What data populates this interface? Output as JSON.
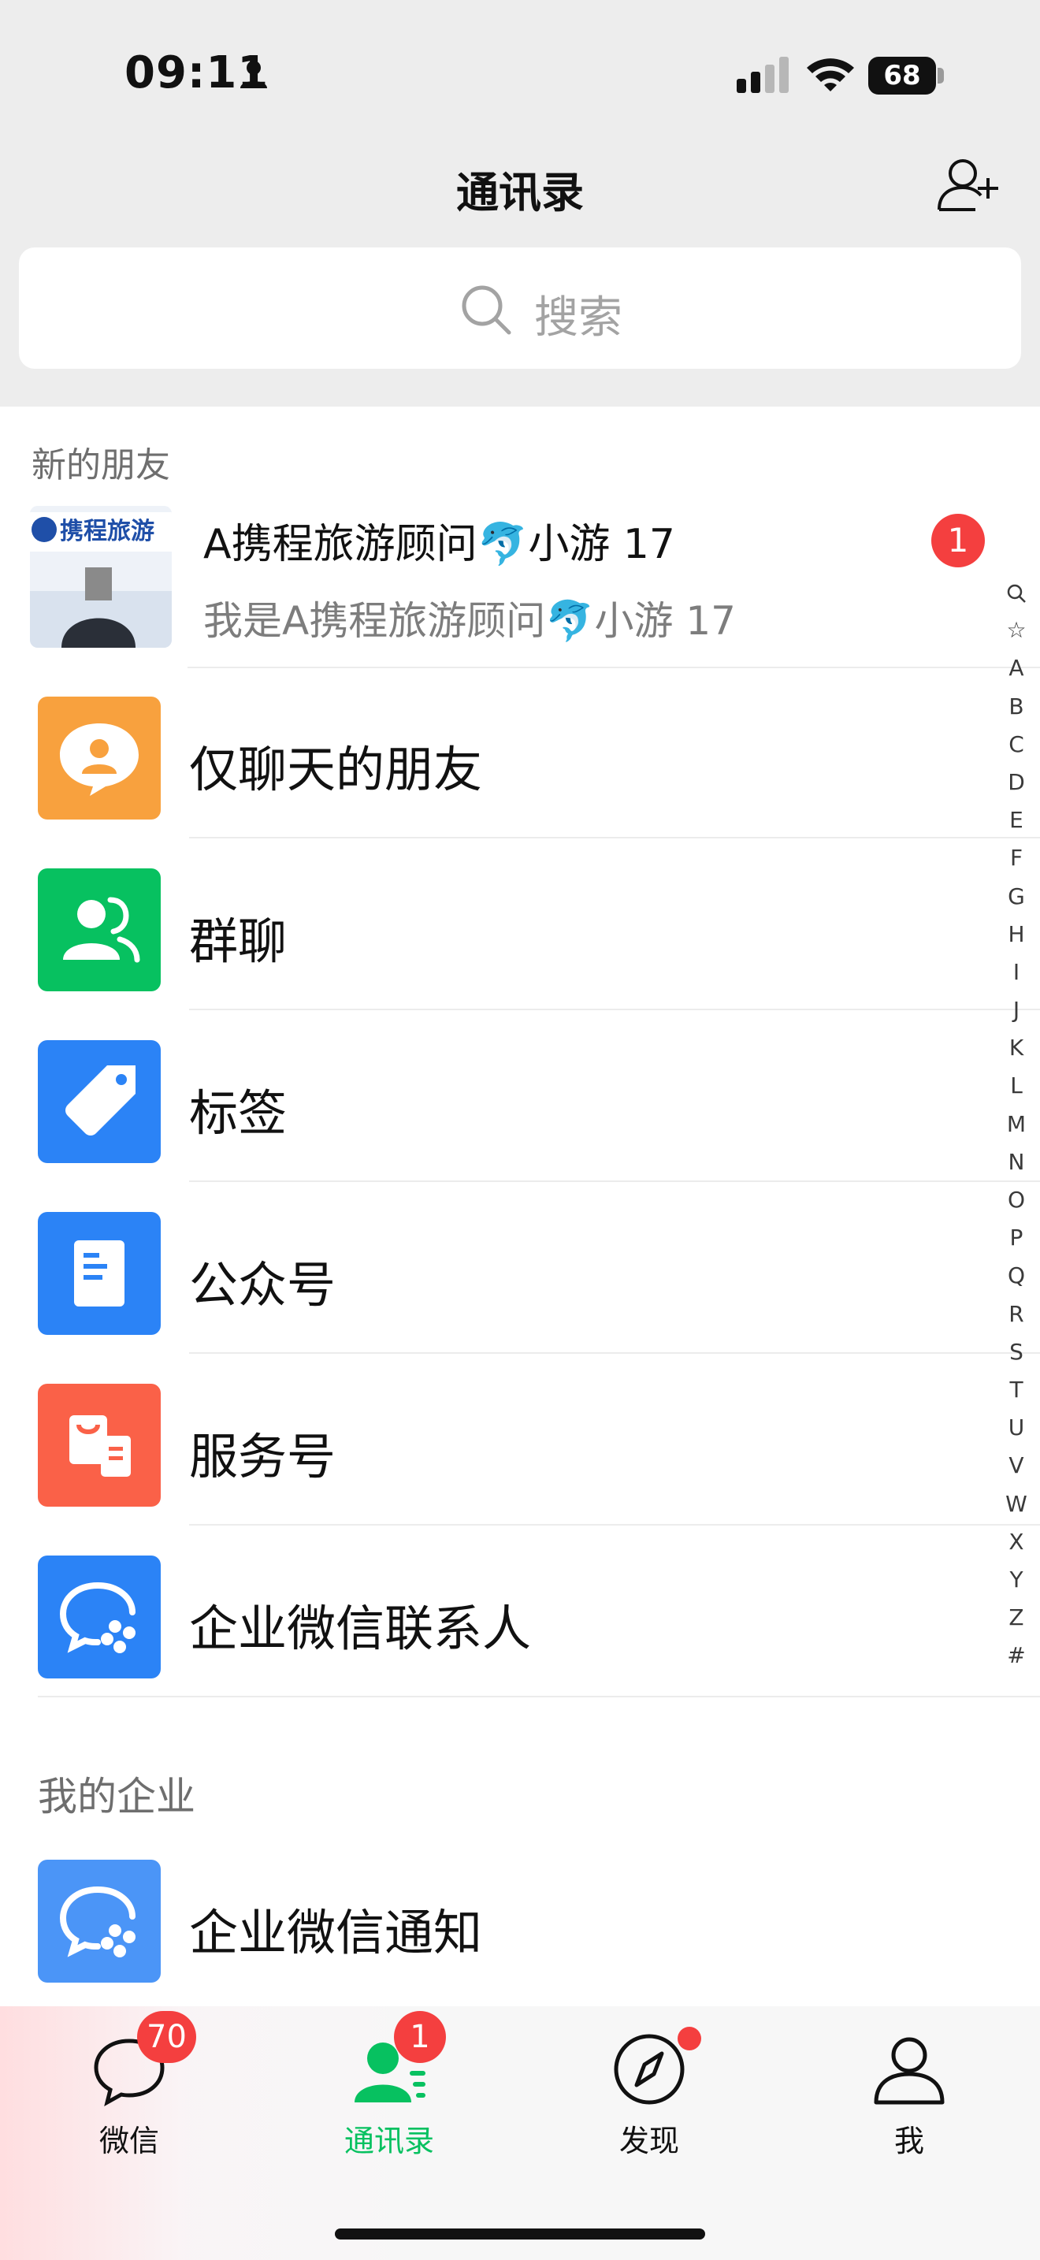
{
  "status_bar": {
    "time": "09:11",
    "battery": "68"
  },
  "header": {
    "title": "通讯录"
  },
  "search": {
    "placeholder": "搜索"
  },
  "new_friends": {
    "section_label": "新的朋友",
    "avatar_text": "携程旅游",
    "name": "A携程旅游顾问🐬小游 17",
    "message": "我是A携程旅游顾问🐬小游 17",
    "badge": "1"
  },
  "contact_rows": [
    {
      "label": "仅聊天的朋友",
      "icon": "chat-only-friend-icon",
      "color": "#f8a13e"
    },
    {
      "label": "群聊",
      "icon": "group-chat-icon",
      "color": "#07c160"
    },
    {
      "label": "标签",
      "icon": "tag-icon",
      "color": "#2b83f6"
    },
    {
      "label": "公众号",
      "icon": "official-account-icon",
      "color": "#2b83f6"
    },
    {
      "label": "服务号",
      "icon": "service-account-icon",
      "color": "#fa6148"
    },
    {
      "label": "企业微信联系人",
      "icon": "wecom-contacts-icon",
      "color": "#2b83f6"
    }
  ],
  "enterprise": {
    "section_label": "我的企业",
    "row_label": "企业微信通知"
  },
  "alpha_index": [
    "Q",
    "☆",
    "A",
    "B",
    "C",
    "D",
    "E",
    "F",
    "G",
    "H",
    "I",
    "J",
    "K",
    "L",
    "M",
    "N",
    "O",
    "P",
    "Q",
    "R",
    "S",
    "T",
    "U",
    "V",
    "W",
    "X",
    "Y",
    "Z",
    "#"
  ],
  "tabs": [
    {
      "label": "微信",
      "badge": "70"
    },
    {
      "label": "通讯录",
      "badge": "1"
    },
    {
      "label": "发现"
    },
    {
      "label": "我"
    }
  ],
  "colors": {
    "accent": "#07c160",
    "badge": "#f43f3f"
  }
}
